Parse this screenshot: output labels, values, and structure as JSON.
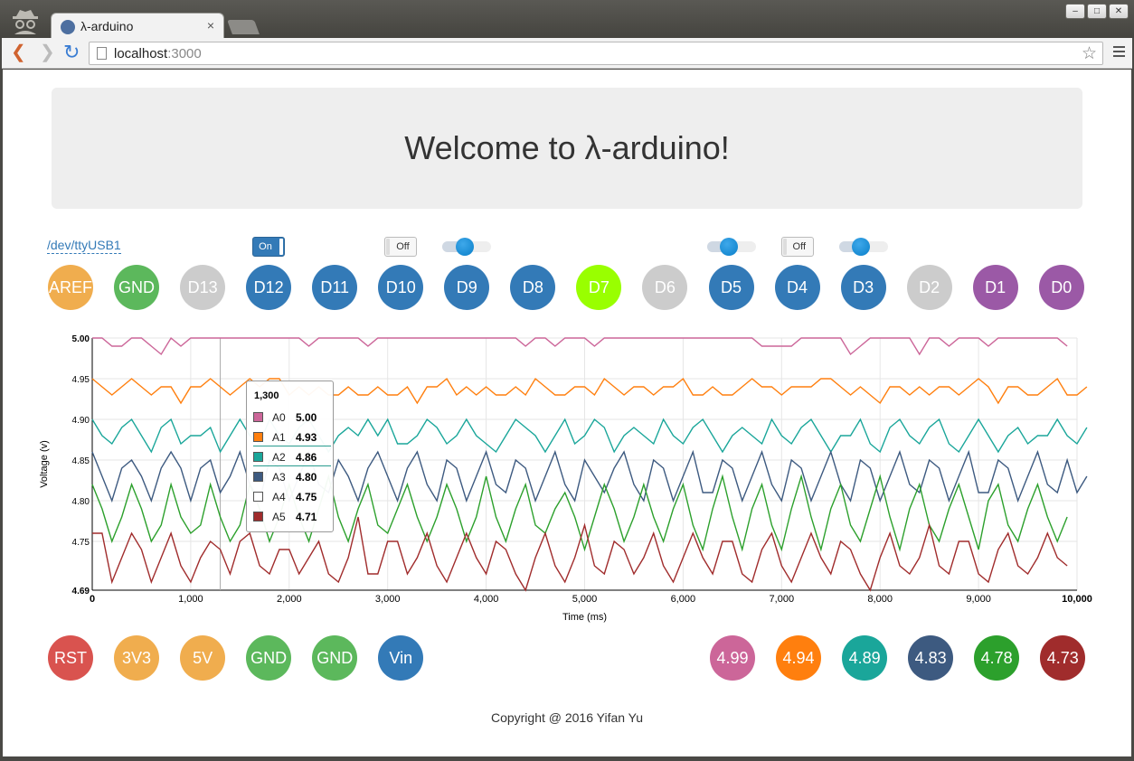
{
  "browser": {
    "tab_title": "λ-arduino",
    "tab_close": "×",
    "url_host": "localhost",
    "url_port": ":3000",
    "minimize": "–",
    "maximize": "□",
    "close": "✕"
  },
  "page": {
    "heading": "Welcome to λ-arduino!",
    "port": "/dev/ttyUSB1",
    "footer": "Copyright @ 2016 Yifan Yu"
  },
  "controls": [
    {
      "type": "toggle",
      "state": "on",
      "label": "On",
      "pin": "D12"
    },
    {
      "type": "toggle",
      "state": "off",
      "label": "Off",
      "pin": "D10"
    },
    {
      "type": "slider",
      "value": 0.45,
      "pin": "D9"
    },
    {
      "type": "slider",
      "value": 0.45,
      "pin": "D5"
    },
    {
      "type": "toggle",
      "state": "off",
      "label": "Off",
      "pin": "D4"
    },
    {
      "type": "slider",
      "value": 0.45,
      "pin": "D3"
    }
  ],
  "digital_pins": [
    {
      "label": "AREF",
      "color": "#f0ad4e"
    },
    {
      "label": "GND",
      "color": "#5cb85c"
    },
    {
      "label": "D13",
      "color": "#cccccc"
    },
    {
      "label": "D12",
      "color": "#337ab7"
    },
    {
      "label": "D11",
      "color": "#337ab7"
    },
    {
      "label": "D10",
      "color": "#337ab7"
    },
    {
      "label": "D9",
      "color": "#337ab7"
    },
    {
      "label": "D8",
      "color": "#337ab7"
    },
    {
      "label": "D7",
      "color": "#99ff00"
    },
    {
      "label": "D6",
      "color": "#cccccc"
    },
    {
      "label": "D5",
      "color": "#337ab7"
    },
    {
      "label": "D4",
      "color": "#337ab7"
    },
    {
      "label": "D3",
      "color": "#337ab7"
    },
    {
      "label": "D2",
      "color": "#cccccc"
    },
    {
      "label": "D1",
      "color": "#9b59a6"
    },
    {
      "label": "D0",
      "color": "#9b59a6"
    }
  ],
  "power_pins": [
    {
      "label": "RST",
      "color": "#d9534f"
    },
    {
      "label": "3V3",
      "color": "#f0ad4e"
    },
    {
      "label": "5V",
      "color": "#f0ad4e"
    },
    {
      "label": "GND",
      "color": "#5cb85c"
    },
    {
      "label": "GND",
      "color": "#5cb85c"
    },
    {
      "label": "Vin",
      "color": "#337ab7"
    }
  ],
  "analog_readouts": [
    {
      "label": "4.99",
      "color": "#cc6699"
    },
    {
      "label": "4.94",
      "color": "#ff7f0e"
    },
    {
      "label": "4.89",
      "color": "#1aa69a"
    },
    {
      "label": "4.83",
      "color": "#3d5a80"
    },
    {
      "label": "4.78",
      "color": "#2ca02c"
    },
    {
      "label": "4.73",
      "color": "#a02c2c"
    }
  ],
  "chart_data": {
    "type": "line",
    "xlabel": "Time (ms)",
    "ylabel": "Voltage (v)",
    "xlim": [
      0,
      10000
    ],
    "ylim": [
      4.69,
      5.0
    ],
    "x_ticks": [
      "0",
      "1,000",
      "2,000",
      "3,000",
      "4,000",
      "5,000",
      "6,000",
      "7,000",
      "8,000",
      "9,000",
      "10,000"
    ],
    "y_ticks": [
      "5.00",
      "4.95",
      "4.90",
      "4.85",
      "4.80",
      "4.75",
      "4.69"
    ],
    "grid": true,
    "x_step": 100,
    "series": [
      {
        "name": "A0",
        "color": "#cc6699",
        "values": [
          5.0,
          5.0,
          4.99,
          4.99,
          5.0,
          5.0,
          4.99,
          4.98,
          5.0,
          4.99,
          5.0,
          5.0,
          5.0,
          5.0,
          5.0,
          5.0,
          5.0,
          5.0,
          5.0,
          5.0,
          5.0,
          5.0,
          4.99,
          5.0,
          5.0,
          5.0,
          5.0,
          5.0,
          4.99,
          5.0,
          5.0,
          5.0,
          5.0,
          5.0,
          5.0,
          5.0,
          5.0,
          5.0,
          5.0,
          5.0,
          5.0,
          5.0,
          5.0,
          5.0,
          4.99,
          5.0,
          5.0,
          4.99,
          5.0,
          5.0,
          5.0,
          4.99,
          5.0,
          5.0,
          5.0,
          5.0,
          5.0,
          5.0,
          5.0,
          5.0,
          5.0,
          5.0,
          5.0,
          5.0,
          5.0,
          5.0,
          5.0,
          5.0,
          4.99,
          4.99,
          4.99,
          4.99,
          5.0,
          5.0,
          5.0,
          5.0,
          5.0,
          4.98,
          4.99,
          5.0,
          5.0,
          5.0,
          5.0,
          5.0,
          4.98,
          5.0,
          5.0,
          4.99,
          5.0,
          5.0,
          5.0,
          4.99,
          5.0,
          5.0,
          5.0,
          5.0,
          5.0,
          5.0,
          5.0,
          4.99
        ]
      },
      {
        "name": "A1",
        "color": "#ff7f0e",
        "values": [
          4.95,
          4.94,
          4.93,
          4.94,
          4.95,
          4.94,
          4.93,
          4.94,
          4.94,
          4.92,
          4.94,
          4.94,
          4.95,
          4.94,
          4.93,
          4.94,
          4.95,
          4.94,
          4.95,
          4.95,
          4.93,
          4.94,
          4.93,
          4.94,
          4.93,
          4.93,
          4.94,
          4.93,
          4.93,
          4.94,
          4.93,
          4.93,
          4.94,
          4.92,
          4.94,
          4.94,
          4.95,
          4.93,
          4.94,
          4.93,
          4.94,
          4.93,
          4.93,
          4.94,
          4.93,
          4.95,
          4.94,
          4.93,
          4.93,
          4.94,
          4.94,
          4.93,
          4.95,
          4.94,
          4.93,
          4.94,
          4.94,
          4.93,
          4.94,
          4.94,
          4.95,
          4.93,
          4.93,
          4.94,
          4.93,
          4.93,
          4.94,
          4.95,
          4.94,
          4.94,
          4.93,
          4.94,
          4.94,
          4.94,
          4.95,
          4.95,
          4.94,
          4.93,
          4.94,
          4.93,
          4.92,
          4.94,
          4.94,
          4.93,
          4.94,
          4.93,
          4.94,
          4.94,
          4.93,
          4.94,
          4.95,
          4.94,
          4.92,
          4.94,
          4.94,
          4.93,
          4.93,
          4.94,
          4.95,
          4.93,
          4.93,
          4.94
        ]
      },
      {
        "name": "A2",
        "color": "#1aa69a",
        "values": [
          4.9,
          4.88,
          4.87,
          4.89,
          4.9,
          4.88,
          4.86,
          4.89,
          4.9,
          4.87,
          4.88,
          4.88,
          4.89,
          4.86,
          4.88,
          4.9,
          4.88,
          4.87,
          4.9,
          4.88,
          4.87,
          4.89,
          4.9,
          4.88,
          4.86,
          4.88,
          4.89,
          4.88,
          4.9,
          4.88,
          4.9,
          4.87,
          4.87,
          4.88,
          4.9,
          4.89,
          4.87,
          4.88,
          4.9,
          4.88,
          4.87,
          4.86,
          4.88,
          4.9,
          4.89,
          4.88,
          4.86,
          4.88,
          4.9,
          4.87,
          4.88,
          4.9,
          4.89,
          4.86,
          4.88,
          4.89,
          4.88,
          4.87,
          4.9,
          4.88,
          4.87,
          4.89,
          4.9,
          4.88,
          4.86,
          4.88,
          4.89,
          4.88,
          4.87,
          4.9,
          4.88,
          4.87,
          4.89,
          4.9,
          4.88,
          4.86,
          4.88,
          4.88,
          4.9,
          4.87,
          4.86,
          4.89,
          4.9,
          4.88,
          4.87,
          4.89,
          4.9,
          4.87,
          4.86,
          4.88,
          4.9,
          4.88,
          4.86,
          4.88,
          4.89,
          4.87,
          4.88,
          4.88,
          4.9,
          4.88,
          4.87,
          4.89
        ]
      },
      {
        "name": "A3",
        "color": "#3d5a80",
        "values": [
          4.86,
          4.83,
          4.8,
          4.84,
          4.85,
          4.83,
          4.8,
          4.84,
          4.86,
          4.84,
          4.8,
          4.84,
          4.85,
          4.81,
          4.83,
          4.86,
          4.82,
          4.8,
          4.85,
          4.84,
          4.8,
          4.83,
          4.86,
          4.82,
          4.81,
          4.85,
          4.83,
          4.8,
          4.84,
          4.86,
          4.83,
          4.8,
          4.84,
          4.86,
          4.82,
          4.8,
          4.85,
          4.84,
          4.8,
          4.83,
          4.86,
          4.82,
          4.81,
          4.85,
          4.84,
          4.8,
          4.83,
          4.86,
          4.82,
          4.8,
          4.85,
          4.83,
          4.81,
          4.84,
          4.86,
          4.82,
          4.8,
          4.85,
          4.84,
          4.8,
          4.83,
          4.86,
          4.81,
          4.81,
          4.85,
          4.84,
          4.8,
          4.83,
          4.86,
          4.82,
          4.8,
          4.85,
          4.84,
          4.8,
          4.83,
          4.86,
          4.82,
          4.8,
          4.85,
          4.84,
          4.8,
          4.83,
          4.86,
          4.82,
          4.81,
          4.85,
          4.84,
          4.8,
          4.83,
          4.86,
          4.81,
          4.81,
          4.85,
          4.84,
          4.8,
          4.83,
          4.86,
          4.82,
          4.81,
          4.85,
          4.81,
          4.83
        ]
      },
      {
        "name": "A4",
        "color": "#2ca02c",
        "values": [
          4.82,
          4.79,
          4.75,
          4.78,
          4.82,
          4.79,
          4.75,
          4.77,
          4.82,
          4.78,
          4.76,
          4.77,
          4.82,
          4.78,
          4.75,
          4.77,
          4.82,
          4.79,
          4.75,
          4.78,
          4.82,
          4.78,
          4.75,
          4.79,
          4.83,
          4.78,
          4.75,
          4.79,
          4.82,
          4.77,
          4.76,
          4.79,
          4.82,
          4.78,
          4.75,
          4.78,
          4.82,
          4.79,
          4.75,
          4.78,
          4.83,
          4.78,
          4.75,
          4.79,
          4.82,
          4.77,
          4.76,
          4.79,
          4.81,
          4.78,
          4.74,
          4.78,
          4.82,
          4.79,
          4.75,
          4.78,
          4.82,
          4.78,
          4.75,
          4.79,
          4.82,
          4.77,
          4.74,
          4.79,
          4.83,
          4.78,
          4.74,
          4.79,
          4.82,
          4.77,
          4.74,
          4.79,
          4.83,
          4.78,
          4.74,
          4.79,
          4.82,
          4.77,
          4.75,
          4.79,
          4.83,
          4.78,
          4.74,
          4.79,
          4.82,
          4.77,
          4.75,
          4.79,
          4.82,
          4.78,
          4.74,
          4.8,
          4.82,
          4.77,
          4.75,
          4.79,
          4.82,
          4.78,
          4.75,
          4.78
        ]
      },
      {
        "name": "A5",
        "color": "#a02c2c",
        "values": [
          4.76,
          4.76,
          4.7,
          4.73,
          4.76,
          4.74,
          4.7,
          4.73,
          4.76,
          4.72,
          4.7,
          4.73,
          4.75,
          4.74,
          4.71,
          4.75,
          4.76,
          4.72,
          4.71,
          4.74,
          4.74,
          4.71,
          4.73,
          4.75,
          4.71,
          4.7,
          4.73,
          4.78,
          4.71,
          4.71,
          4.75,
          4.75,
          4.71,
          4.73,
          4.76,
          4.72,
          4.7,
          4.73,
          4.76,
          4.73,
          4.71,
          4.75,
          4.74,
          4.71,
          4.69,
          4.73,
          4.76,
          4.72,
          4.7,
          4.73,
          4.77,
          4.72,
          4.71,
          4.75,
          4.74,
          4.71,
          4.73,
          4.76,
          4.72,
          4.7,
          4.73,
          4.76,
          4.73,
          4.71,
          4.75,
          4.75,
          4.71,
          4.7,
          4.74,
          4.76,
          4.72,
          4.7,
          4.73,
          4.76,
          4.73,
          4.71,
          4.75,
          4.74,
          4.71,
          4.69,
          4.73,
          4.76,
          4.72,
          4.71,
          4.73,
          4.77,
          4.72,
          4.71,
          4.75,
          4.75,
          4.71,
          4.7,
          4.74,
          4.76,
          4.72,
          4.71,
          4.73,
          4.76,
          4.73,
          4.72
        ]
      }
    ],
    "tooltip": {
      "x_label": "1,300",
      "items": [
        {
          "name": "A0",
          "value": "5.00",
          "color": "#cc6699"
        },
        {
          "name": "A1",
          "value": "4.93",
          "color": "#ff7f0e"
        },
        {
          "name": "A2",
          "value": "4.86",
          "color": "#1aa69a"
        },
        {
          "name": "A3",
          "value": "4.80",
          "color": "#3d5a80"
        },
        {
          "name": "A4",
          "value": "4.75",
          "color": "#ffffff"
        },
        {
          "name": "A5",
          "value": "4.71",
          "color": "#a02c2c"
        }
      ]
    }
  }
}
